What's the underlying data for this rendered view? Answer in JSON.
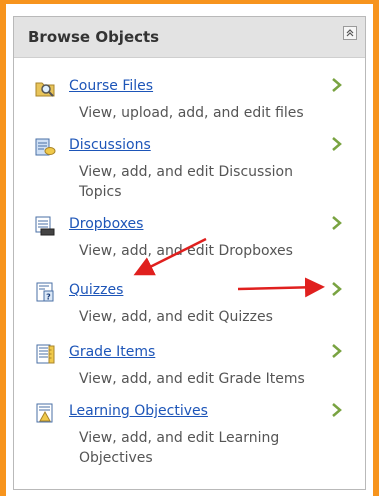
{
  "widget": {
    "title": "Browse Objects"
  },
  "items": [
    {
      "label": "Course Files",
      "description": "View, upload, add, and edit files",
      "icon": "folder-search-icon"
    },
    {
      "label": "Discussions",
      "description": "View, add, and edit Discussion Topics",
      "icon": "discussions-icon"
    },
    {
      "label": "Dropboxes",
      "description": "View, add, and edit Dropboxes",
      "icon": "dropbox-icon"
    },
    {
      "label": "Quizzes",
      "description": "View, add, and edit Quizzes",
      "icon": "quiz-icon"
    },
    {
      "label": "Grade Items",
      "description": "View, add, and edit Grade Items",
      "icon": "grade-items-icon"
    },
    {
      "label": "Learning Objectives",
      "description": "View, add, and edit Learning Objectives",
      "icon": "learning-objectives-icon"
    }
  ],
  "colors": {
    "accent_border": "#f7941d",
    "link": "#1d55b8",
    "arrow": "#79a341",
    "annotation": "#e0201e"
  }
}
